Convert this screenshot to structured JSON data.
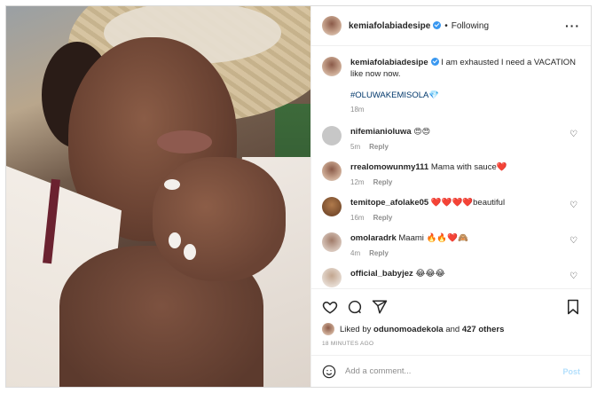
{
  "header": {
    "username": "kemiafolabiadesipe",
    "separator": "•",
    "follow_status": "Following",
    "more_icon": "more-horizontal-icon"
  },
  "caption": {
    "username": "kemiafolabiadesipe",
    "text": "I am exhausted I need a VACATION like now now.",
    "hashtag": "#OLUWAKEMISOLA💎",
    "time": "18m"
  },
  "comments": [
    {
      "username": "nifemianioluwa",
      "text": "😍😍",
      "time": "5m",
      "reply_label": "Reply"
    },
    {
      "username": "rrealomowunmy111",
      "text": "Mama with sauce❤️",
      "time": "12m",
      "reply_label": "Reply"
    },
    {
      "username": "temitope_afolake05",
      "text": "❤️❤️❤️❤️beautiful",
      "time": "16m",
      "reply_label": "Reply"
    },
    {
      "username": "omolaradrk",
      "text": "Maami 🔥🔥❤️🙈",
      "time": "4m",
      "reply_label": "Reply"
    },
    {
      "username": "official_babyjez",
      "text": "😂😂😂",
      "time": "",
      "reply_label": ""
    }
  ],
  "likes": {
    "prefix": "Liked by",
    "liker": "odunomoadekola",
    "joiner": "and",
    "others": "427 others"
  },
  "post_time": "18 MINUTES AGO",
  "add_comment": {
    "placeholder": "Add a comment...",
    "post_label": "Post"
  },
  "colors": {
    "verified": "#3897f0",
    "hashtag": "#00376b",
    "post_button_disabled": "#b2dffc",
    "meta_text": "#8e8e8e"
  }
}
